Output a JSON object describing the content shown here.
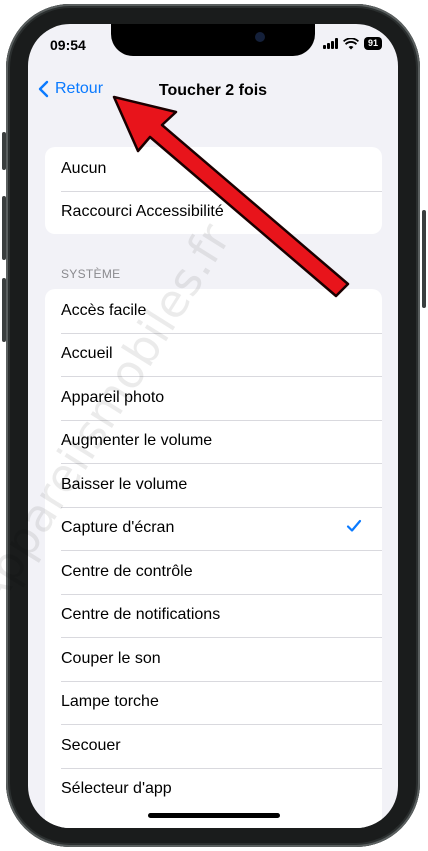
{
  "status_bar": {
    "time": "09:54",
    "battery": "91"
  },
  "nav": {
    "back_label": "Retour",
    "title": "Toucher 2 fois"
  },
  "group1": {
    "items": [
      "Aucun",
      "Raccourci Accessibilité"
    ]
  },
  "section_system": {
    "header": "SYSTÈME",
    "items": [
      "Accès facile",
      "Accueil",
      "Appareil photo",
      "Augmenter le volume",
      "Baisser le volume",
      "Capture d'écran",
      "Centre de contrôle",
      "Centre de notifications",
      "Couper le son",
      "Lampe torche",
      "Secouer",
      "Sélecteur d'app"
    ],
    "selected": "Capture d'écran"
  },
  "watermark": "Appareilsmobiles.fr",
  "colors": {
    "accent": "#0a7aff",
    "arrow": "#e8141b",
    "background": "#f2f2f7"
  },
  "icons": [
    "chevron-left-icon",
    "checkmark-icon",
    "signal-icon",
    "wifi-icon",
    "battery-icon",
    "red-arrow-annotation"
  ]
}
